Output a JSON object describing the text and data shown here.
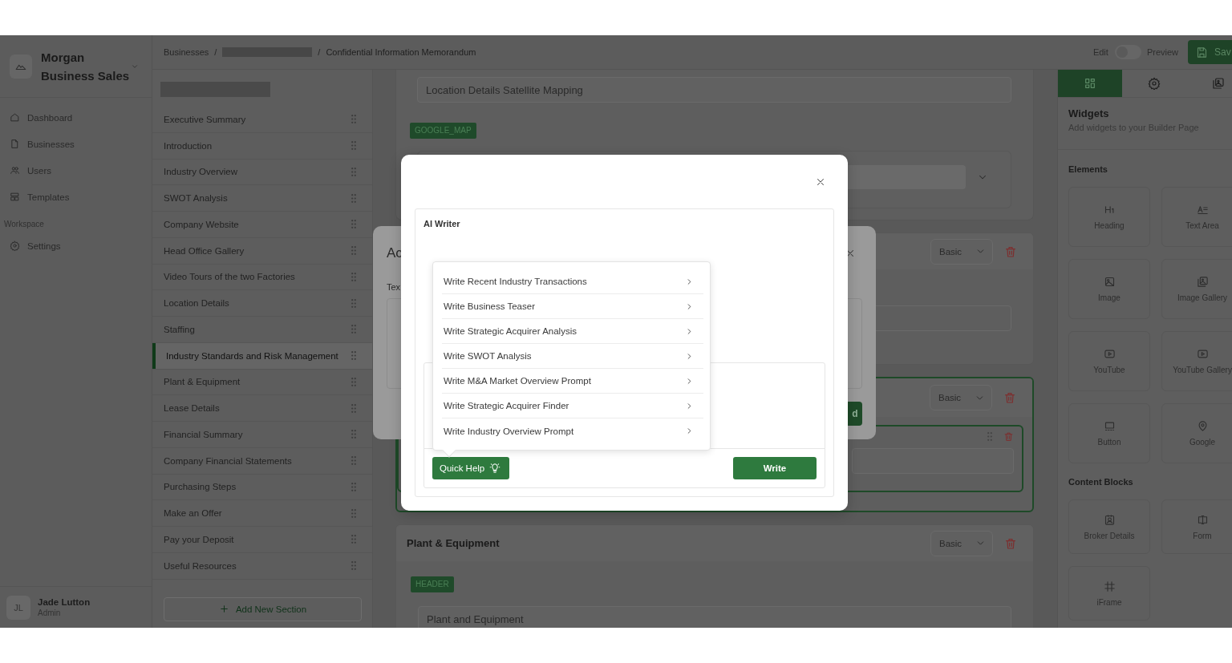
{
  "sidebar": {
    "brand": "Morgan Business Sales",
    "nav": [
      {
        "label": "Dashboard"
      },
      {
        "label": "Businesses"
      },
      {
        "label": "Users"
      },
      {
        "label": "Templates"
      }
    ],
    "workspace": {
      "label": "Workspace",
      "items": [
        {
          "label": "Settings"
        }
      ]
    },
    "user": {
      "initials": "JL",
      "name": "Jade Lutton",
      "role": "Admin"
    }
  },
  "breadcrumb": [
    {
      "kind": "link",
      "label": "Businesses"
    },
    {
      "kind": "separator",
      "label": "/"
    },
    {
      "kind": "redacted"
    },
    {
      "kind": "separator",
      "label": "/"
    },
    {
      "kind": "current",
      "label": "Confidential Information Memorandum"
    }
  ],
  "top_bar": {
    "edit_label": "Edit",
    "toggle_on": false,
    "preview_label": "Preview",
    "save_label": "Sav"
  },
  "sections": {
    "items": [
      {
        "label": "Executive Summary",
        "selected": false
      },
      {
        "label": "Introduction",
        "selected": false
      },
      {
        "label": "Industry Overview",
        "selected": false
      },
      {
        "label": "SWOT Analysis",
        "selected": false
      },
      {
        "label": "Company Website",
        "selected": false
      },
      {
        "label": "Head Office Gallery",
        "selected": false
      },
      {
        "label": "Video Tours of the two Factories",
        "selected": false
      },
      {
        "label": "Location Details",
        "selected": false
      },
      {
        "label": "Staffing",
        "selected": false
      },
      {
        "label": "Industry Standards and Risk Management",
        "selected": true
      },
      {
        "label": "Plant & Equipment",
        "selected": false
      },
      {
        "label": "Lease Details",
        "selected": false
      },
      {
        "label": "Financial Summary",
        "selected": false
      },
      {
        "label": "Company Financial Statements",
        "selected": false
      },
      {
        "label": "Purchasing Steps",
        "selected": false
      },
      {
        "label": "Make an Offer",
        "selected": false
      },
      {
        "label": "Pay your Deposit",
        "selected": false
      },
      {
        "label": "Useful Resources",
        "selected": false
      }
    ],
    "add_button": "Add New Section"
  },
  "editor": {
    "map_block": {
      "field_value": "Location Details Satellite Mapping",
      "tag": "GOOGLE_MAP"
    },
    "sections": [
      {
        "select": "Basic",
        "highlighted": false
      },
      {
        "select": "Basic",
        "highlighted": true
      },
      {
        "title": "Plant & Equipment",
        "select": "Basic",
        "highlighted": false,
        "tag": "HEADER",
        "field_value": "Plant and Equipment"
      }
    ]
  },
  "right_panel": {
    "tabs": [
      {
        "selected": true
      },
      {
        "selected": false
      },
      {
        "selected": false
      }
    ],
    "title": "Widgets",
    "subtitle": "Add widgets to your Builder Page",
    "groups": [
      {
        "heading": "Elements",
        "widgets": [
          {
            "label": "Heading"
          },
          {
            "label": "Text Area"
          },
          {
            "label": "Image"
          },
          {
            "label": "Image Gallery"
          },
          {
            "label": "YouTube"
          },
          {
            "label": "YouTube Gallery"
          },
          {
            "label": "Button"
          },
          {
            "label": "Google"
          }
        ]
      },
      {
        "heading": "Content Blocks",
        "widgets": [
          {
            "label": "Broker Details"
          },
          {
            "label": "Form"
          },
          {
            "label": "iFrame"
          }
        ]
      }
    ]
  },
  "back_dialog": {
    "title": "Ac",
    "label": "Tex",
    "button": "d"
  },
  "ai_writer": {
    "title": "AI Writer",
    "menu": [
      "Write Recent Industry Transactions",
      "Write Business Teaser",
      "Write Strategic Acquirer Analysis",
      "Write SWOT Analysis",
      "Write M&A Market Overview Prompt",
      "Write Strategic Acquirer Finder",
      "Write Industry Overview Prompt"
    ],
    "quick_help": "Quick Help",
    "write": "Write"
  }
}
